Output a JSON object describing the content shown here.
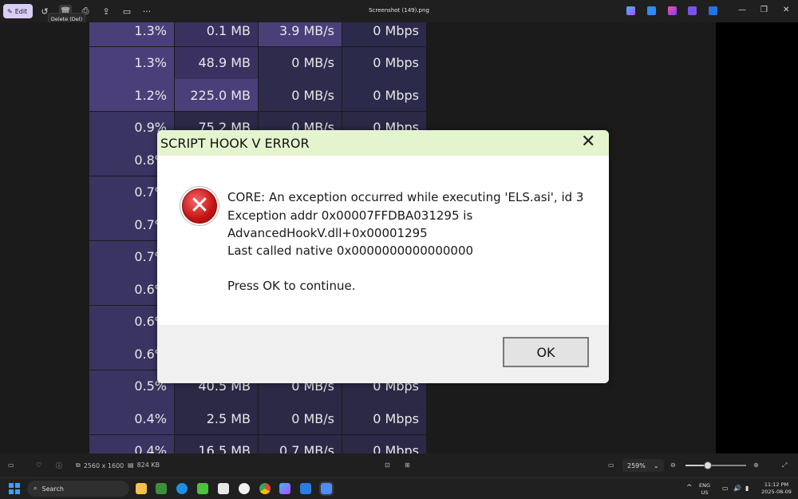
{
  "toolbar": {
    "edit_label": "Edit",
    "tooltip": "Delete (Del)",
    "file_title": "Screenshot (149).png",
    "more_label": "···"
  },
  "task_manager": {
    "rows": [
      {
        "cpu": "1.3%",
        "mem": "0.1 MB",
        "disk": "3.9 MB/s",
        "net": "0 Mbps"
      },
      {
        "cpu": "1.3%",
        "mem": "48.9 MB",
        "disk": "0 MB/s",
        "net": "0 Mbps"
      },
      {
        "cpu": "1.2%",
        "mem": "225.0 MB",
        "disk": "0 MB/s",
        "net": "0 Mbps"
      },
      {
        "cpu": "0.9%",
        "mem": "75.2 MB",
        "disk": "0 MB/s",
        "net": "0 Mbps"
      },
      {
        "cpu": "0.8%",
        "mem": "",
        "disk": "",
        "net": ""
      },
      {
        "cpu": "0.7%",
        "mem": "",
        "disk": "",
        "net": ""
      },
      {
        "cpu": "0.7%",
        "mem": "",
        "disk": "",
        "net": ""
      },
      {
        "cpu": "0.7%",
        "mem": "",
        "disk": "",
        "net": ""
      },
      {
        "cpu": "0.6%",
        "mem": "",
        "disk": "",
        "net": ""
      },
      {
        "cpu": "0.6%",
        "mem": "",
        "disk": "",
        "net": ""
      },
      {
        "cpu": "0.6%",
        "mem": "",
        "disk": "",
        "net": ""
      },
      {
        "cpu": "0.5%",
        "mem": "40.5 MB",
        "disk": "0 MB/s",
        "net": "0 Mbps"
      },
      {
        "cpu": "0.4%",
        "mem": "2.5 MB",
        "disk": "0 MB/s",
        "net": "0 Mbps"
      },
      {
        "cpu": "0.4%",
        "mem": "16.5 MB",
        "disk": "0.7 MB/s",
        "net": "0 Mbps"
      }
    ]
  },
  "dialog": {
    "title": "SCRIPT HOOK V ERROR",
    "close_glyph": "✕",
    "line1": "CORE: An exception occurred while executing 'ELS.asi', id 3",
    "line2": "Exception addr 0x00007FFDBA031295 is",
    "line3": "AdvancedHookV.dll+0x00001295",
    "line4": "Last called native 0x0000000000000000",
    "line5": "Press OK to continue.",
    "ok_label": "OK"
  },
  "status": {
    "resolution": "2560 x 1600",
    "filesize": "824 KB",
    "zoom": "259%",
    "zoom_level": 0.35
  },
  "taskbar": {
    "search_placeholder": "Search",
    "lang_line1": "ENG",
    "lang_line2": "US",
    "time": "11:12 PM",
    "date": "2025-08-09"
  }
}
